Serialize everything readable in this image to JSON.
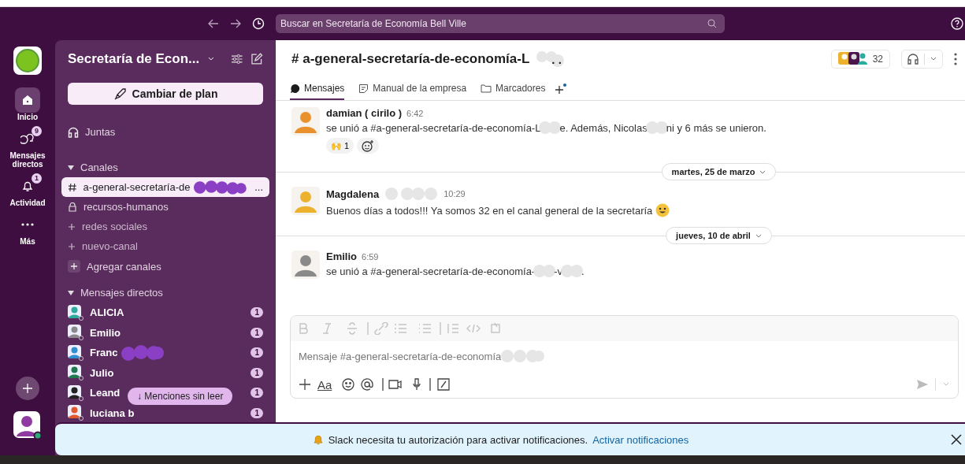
{
  "top_bar": {
    "search_placeholder": "Buscar en Secretaría de Economía Bell Ville"
  },
  "rail": {
    "items": [
      {
        "kind": "home",
        "label": "Inicio",
        "selected": true
      },
      {
        "kind": "dm",
        "label": "Mensajes directos",
        "selected": false,
        "badge": "9"
      },
      {
        "kind": "bell",
        "label": "Actividad",
        "selected": false,
        "badge": "1"
      },
      {
        "kind": "more",
        "label": "Más",
        "selected": false
      }
    ]
  },
  "sidebar": {
    "workspace": "Secretaría de Econ...",
    "upgrade_button": "Cambiar de plan",
    "huddles": "Juntas",
    "channels_header": "Canales",
    "channels": [
      {
        "kind": "public",
        "name": "a-general-secretaría-de",
        "redacted": true,
        "tail": "...",
        "selected": true
      },
      {
        "kind": "private",
        "name": "recursos-humanos",
        "selected": false
      },
      {
        "kind": "pending",
        "name": "redes sociales",
        "selected": false
      },
      {
        "kind": "pending",
        "name": "nuevo-canal",
        "selected": false
      }
    ],
    "add_channels": "Agregar canales",
    "dm_header": "Mensajes directos",
    "dms": [
      {
        "name": "ALICIA",
        "badge": "1",
        "color": "#2bac9c"
      },
      {
        "name": "Emilio",
        "badge": "1",
        "color": "#8a8a8a"
      },
      {
        "name": "Franc",
        "redacted": true,
        "badge": "1",
        "color": "#2f8fd0"
      },
      {
        "name": "Julio",
        "badge": "1",
        "color": "#1e7a4f"
      },
      {
        "name": "Leand",
        "badge": "1",
        "color": "#222222"
      },
      {
        "name": "luciana b",
        "badge": "1",
        "color": "#e05a2b"
      }
    ],
    "mentions_pill": "↓ Menciones sin leer"
  },
  "channel": {
    "title": "# a-general-secretaría-de-economía-L",
    "title_redacted": true,
    "title_tail": ". .",
    "member_count": "32",
    "tabs": [
      {
        "kind": "messages",
        "label": "Mensajes",
        "selected": true
      },
      {
        "kind": "canvas",
        "label": "Manual de la empresa",
        "selected": false
      },
      {
        "kind": "folder",
        "label": "Marcadores",
        "selected": false
      }
    ]
  },
  "messages": [
    {
      "kind": "message",
      "author": "damian ( cirilo )",
      "time": "6:42",
      "color": "#e8912d",
      "segments": [
        "se unió a #a-general-secretaría-de-economía-L",
        "e. Además, Nicolas",
        "ni y 6 más se unieron."
      ],
      "reactions": [
        {
          "emoji": "🙌",
          "count": "1"
        }
      ]
    },
    {
      "kind": "divider",
      "label": "martes, 25 de marzo"
    },
    {
      "kind": "message",
      "author": "Magdalena",
      "author_redacted": true,
      "time": "10:29",
      "color": "#ecb22e",
      "segments": [
        "Buenos días a todos!!! Ya somos 32 en el canal general de la secretaría"
      ],
      "smiley": true
    },
    {
      "kind": "divider",
      "label": "jueves, 10 de abril"
    },
    {
      "kind": "message",
      "author": "Emilio",
      "time": "6:59",
      "color": "#8a8a8a",
      "segments": [
        "se unió a #a-general-secretaría-de-economía-",
        "-v",
        "."
      ]
    }
  ],
  "composer": {
    "format_button": "Aa",
    "placeholder": "Mensaje #a-general-secretaría-de-economía",
    "placeholder_redacted": true
  },
  "banner": {
    "text": "Slack necesita tu autorización para activar notificaciones.",
    "link": "Activar notificaciones"
  }
}
